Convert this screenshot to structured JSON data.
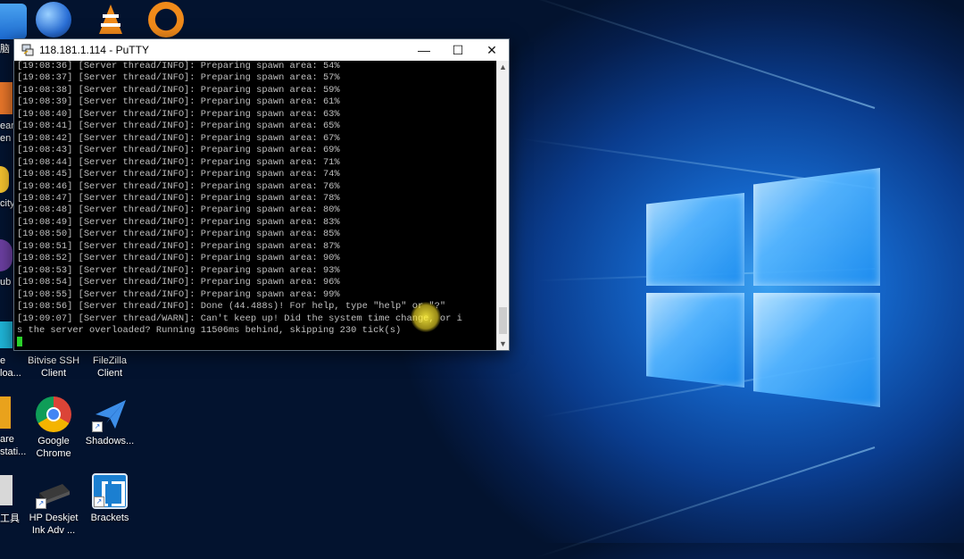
{
  "desktop": {
    "icons": [
      {
        "id": "bitvise",
        "label": "Bitvise SSH\nClient",
        "icon": "bitvise-icon"
      },
      {
        "id": "filezilla",
        "label": "FileZilla\nClient",
        "icon": "filezilla-icon"
      },
      {
        "id": "chrome",
        "label": "Google\nChrome",
        "icon": "chrome-icon"
      },
      {
        "id": "shadows",
        "label": "Shadows...",
        "icon": "paper-plane-icon"
      },
      {
        "id": "hp",
        "label": "HP Deskjet\nInk Adv ...",
        "icon": "printer-icon"
      },
      {
        "id": "brackets",
        "label": "Brackets",
        "icon": "brackets-icon"
      }
    ],
    "partial_labels": [
      "脑",
      "ean",
      "en",
      "city",
      "ub",
      "e",
      "loa...",
      "are",
      "stati...",
      "工具"
    ]
  },
  "putty": {
    "title": "118.181.1.114 - PuTTY",
    "controls": {
      "minimize": "—",
      "maximize": "☐",
      "close": "✕"
    },
    "lines": [
      "[19:08:36] [Server thread/INFO]: Preparing spawn area: 54%",
      "[19:08:37] [Server thread/INFO]: Preparing spawn area: 57%",
      "[19:08:38] [Server thread/INFO]: Preparing spawn area: 59%",
      "[19:08:39] [Server thread/INFO]: Preparing spawn area: 61%",
      "[19:08:40] [Server thread/INFO]: Preparing spawn area: 63%",
      "[19:08:41] [Server thread/INFO]: Preparing spawn area: 65%",
      "[19:08:42] [Server thread/INFO]: Preparing spawn area: 67%",
      "[19:08:43] [Server thread/INFO]: Preparing spawn area: 69%",
      "[19:08:44] [Server thread/INFO]: Preparing spawn area: 71%",
      "[19:08:45] [Server thread/INFO]: Preparing spawn area: 74%",
      "[19:08:46] [Server thread/INFO]: Preparing spawn area: 76%",
      "[19:08:47] [Server thread/INFO]: Preparing spawn area: 78%",
      "[19:08:48] [Server thread/INFO]: Preparing spawn area: 80%",
      "[19:08:49] [Server thread/INFO]: Preparing spawn area: 83%",
      "[19:08:50] [Server thread/INFO]: Preparing spawn area: 85%",
      "[19:08:51] [Server thread/INFO]: Preparing spawn area: 87%",
      "[19:08:52] [Server thread/INFO]: Preparing spawn area: 90%",
      "[19:08:53] [Server thread/INFO]: Preparing spawn area: 93%",
      "[19:08:54] [Server thread/INFO]: Preparing spawn area: 96%",
      "[19:08:55] [Server thread/INFO]: Preparing spawn area: 99%",
      "[19:08:56] [Server thread/INFO]: Done (44.488s)! For help, type \"help\" or \"?\"",
      "[19:09:07] [Server thread/WARN]: Can't keep up! Did the system time change, or i",
      "s the server overloaded? Running 11506ms behind, skipping 230 tick(s)"
    ],
    "cursor_color": "#2bd12b"
  }
}
